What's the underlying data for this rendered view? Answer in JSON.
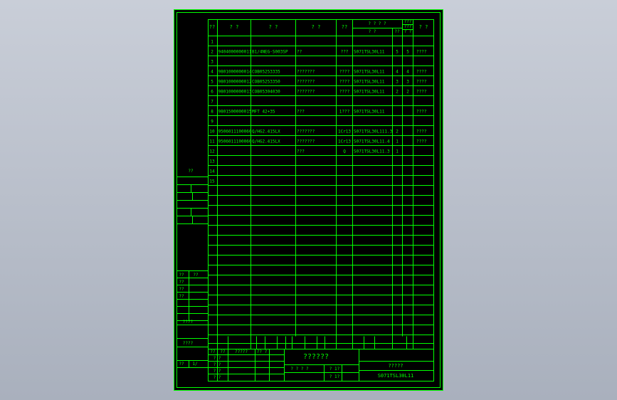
{
  "colors": {
    "line": "#00ff00",
    "paper": "#000000",
    "viewport": "#b8bec9"
  },
  "header": {
    "seq": "??",
    "code": "? ?",
    "name": "? ?",
    "spec": "? ?",
    "qty": "??",
    "group_top": "? ? ? ?",
    "group_a": "? ?",
    "group_b": "??",
    "small_top": "???",
    "small_mid": "???",
    "small_bot": "? ?",
    "remark": "? ?"
  },
  "rows": [
    {
      "no": "1",
      "code": "",
      "name": "",
      "spec": "",
      "qty": "",
      "ref": "",
      "a": "",
      "b": "",
      "remark": ""
    },
    {
      "no": "2",
      "code": "9404000000011",
      "name": "B1/4NEG-S003SP",
      "spec": "??",
      "qty": "???",
      "ref": "S071TSL30L11",
      "a": "5",
      "b": "5",
      "remark": "????"
    },
    {
      "no": "3",
      "code": "",
      "name": "",
      "spec": "",
      "qty": "",
      "ref": "",
      "a": "",
      "b": "",
      "remark": ""
    },
    {
      "no": "4",
      "code": "9801000000014",
      "name": "COB05253335",
      "spec": "???????",
      "qty": "????",
      "ref": "S071TSL30L11",
      "a": "4",
      "b": "4",
      "remark": "????"
    },
    {
      "no": "5",
      "code": "9801000000012",
      "name": "COB05253350",
      "spec": "???????",
      "qty": "????",
      "ref": "S071TSL30L11",
      "a": "3",
      "b": "3",
      "remark": "????"
    },
    {
      "no": "6",
      "code": "9801000000013",
      "name": "COB05304030",
      "spec": "???????",
      "qty": "????",
      "ref": "S071TSL30L11",
      "a": "2",
      "b": "2",
      "remark": "????"
    },
    {
      "no": "7",
      "code": "",
      "name": "",
      "spec": "",
      "qty": "",
      "ref": "",
      "a": "",
      "b": "",
      "remark": ""
    },
    {
      "no": "8",
      "code": "9801500000015",
      "name": "MFT 42+35",
      "spec": "???",
      "qty": "1???",
      "ref": "S071TSL30L11",
      "a": "",
      "b": "",
      "remark": "????"
    },
    {
      "no": "9",
      "code": "",
      "name": "",
      "spec": "",
      "qty": "",
      "ref": "",
      "a": "",
      "b": "",
      "remark": ""
    },
    {
      "no": "10",
      "code": "9506011100060",
      "name": "Q/HG2.415LX",
      "spec": "???????",
      "qty": "1Cr13",
      "ref": "S071TSL30L111.3",
      "a": "2",
      "b": "",
      "remark": "????"
    },
    {
      "no": "11",
      "code": "9506011100060",
      "name": "Q/HG2.415LX",
      "spec": "???????",
      "qty": "1Cr13",
      "ref": "S071TSL30L11.4",
      "a": "1",
      "b": "",
      "remark": "????"
    },
    {
      "no": "12",
      "code": "",
      "name": "",
      "spec": "???",
      "qty": "Q",
      "ref": "S071TSL30L11.3",
      "a": "1",
      "b": "",
      "remark": ""
    },
    {
      "no": "13",
      "code": "",
      "name": "",
      "spec": "",
      "qty": "",
      "ref": "",
      "a": "",
      "b": "",
      "remark": ""
    },
    {
      "no": "14",
      "code": "",
      "name": "",
      "spec": "",
      "qty": "",
      "ref": "",
      "a": "",
      "b": "",
      "remark": ""
    },
    {
      "no": "15",
      "code": "",
      "name": "",
      "spec": "",
      "qty": "",
      "ref": "",
      "a": "",
      "b": "",
      "remark": ""
    }
  ],
  "side": {
    "label_top": "??",
    "mid_labels": [
      "??",
      "??",
      "??",
      "??"
    ],
    "mid_right": "??",
    "label_a": "????",
    "label_b": "????",
    "bottom_left": "??",
    "bottom_right": "1/"
  },
  "title_block": {
    "sig_labels": [
      "??",
      "??",
      "?????",
      "?? ?"
    ],
    "sig_rows": [
      "? ?",
      "? ?",
      "? ?",
      "? ?"
    ],
    "drawing_name": "??????",
    "scale_labels": [
      "? ? ? ?",
      "? 1?",
      "? 1?"
    ],
    "company": "?????",
    "drawing_number": "S071TSL30L11"
  }
}
